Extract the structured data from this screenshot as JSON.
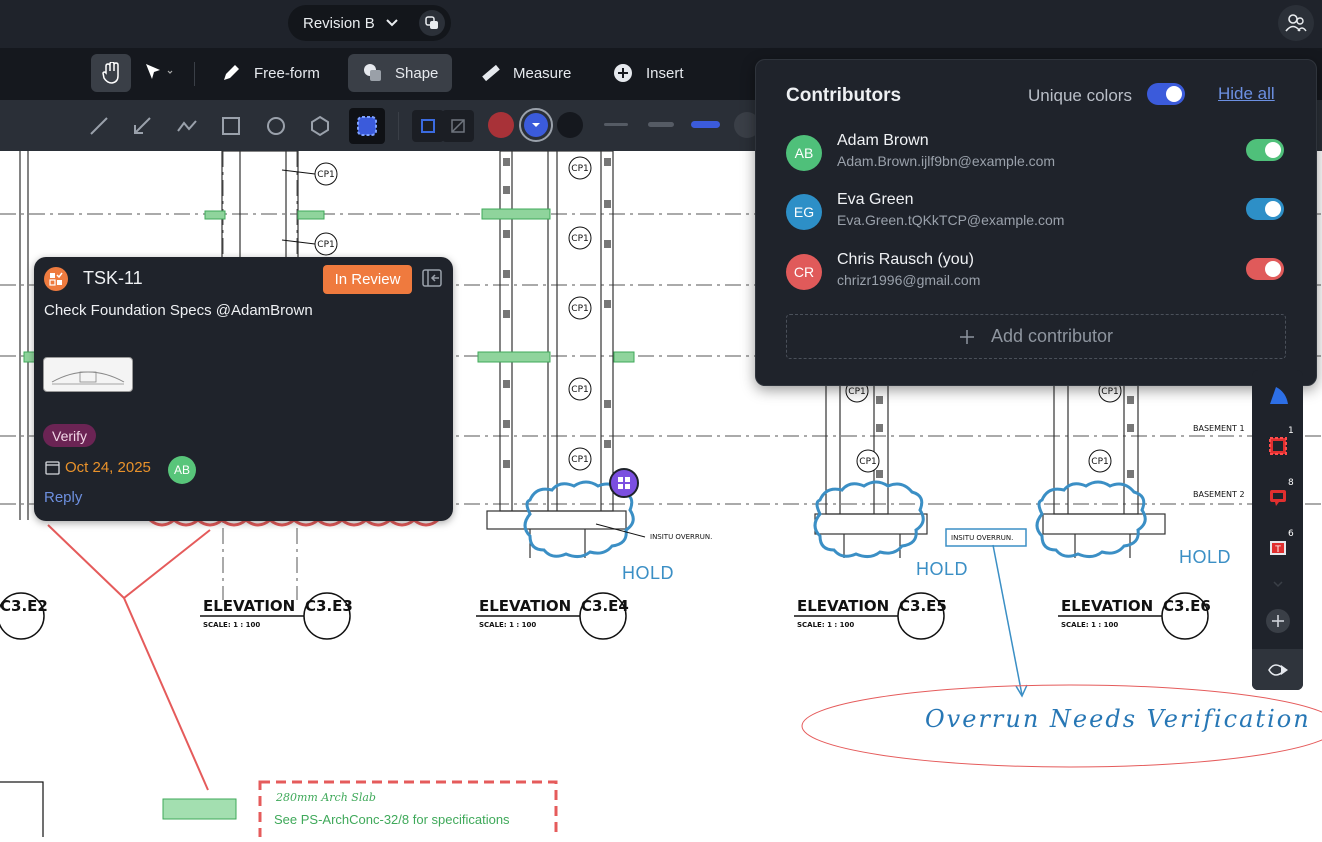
{
  "header": {
    "revision_label": "Revision B"
  },
  "toolbar": {
    "tools": [
      {
        "label": "Free-form",
        "icon": "pen-icon"
      },
      {
        "label": "Shape",
        "icon": "shape-icon"
      },
      {
        "label": "Measure",
        "icon": "ruler-icon"
      },
      {
        "label": "Insert",
        "icon": "plus-circle-icon"
      }
    ],
    "active": "Shape"
  },
  "task_card": {
    "id": "TSK-11",
    "status": "In Review",
    "title": "Check Foundation Specs @AdamBrown",
    "tag": "Verify",
    "due_date": "Oct 24, 2025",
    "assignee_initials": "AB",
    "reply_label": "Reply"
  },
  "contributors_panel": {
    "title": "Contributors",
    "unique_colors_label": "Unique colors",
    "unique_colors_on": true,
    "hide_all_label": "Hide all",
    "contributors": [
      {
        "initials": "AB",
        "name": "Adam Brown",
        "email": "Adam.Brown.ijlf9bn@example.com",
        "color": "#4fc07a",
        "visible": true
      },
      {
        "initials": "EG",
        "name": "Eva Green",
        "email": "Eva.Green.tQKkTCP@example.com",
        "color": "#2d8fc7",
        "visible": true
      },
      {
        "initials": "CR",
        "name": "Chris Rausch (you)",
        "email": "chrizr1996@gmail.com",
        "color": "#e05a5a",
        "visible": true
      }
    ],
    "add_label": "Add contributor"
  },
  "side_rail": {
    "badges": [
      "1",
      "8",
      "6"
    ]
  },
  "drawing": {
    "elevations": [
      {
        "label": "ELEVATION",
        "ref": "C3.E3",
        "scale": "SCALE:   1 : 100"
      },
      {
        "label": "ELEVATION",
        "ref": "C3.E4",
        "scale": "SCALE:   1 : 100"
      },
      {
        "label": "ELEVATION",
        "ref": "C3.E5",
        "scale": "SCALE:   1 : 100"
      },
      {
        "label": "ELEVATION",
        "ref": "C3.E6",
        "scale": "SCALE:   1 : 100"
      }
    ],
    "partial_ref": "C3.E2",
    "pile_label": "CP1",
    "insitu_label": "INSITU OVERRUN.",
    "basement_labels": [
      "BASEMENT 1",
      "BASEMENT 2"
    ],
    "hold_label": "HOLD",
    "handwritten_note": "Overrun Needs Verification",
    "slab_note_handwritten": "280mm Arch Slab",
    "slab_note_text": "See PS-ArchConc-32/8 for specifications"
  },
  "colors": {
    "accent_blue": "#3b5bdb",
    "status_orange": "#ef7a3e",
    "markup_red": "#e55b5b",
    "markup_blue": "#3b8fc5"
  }
}
